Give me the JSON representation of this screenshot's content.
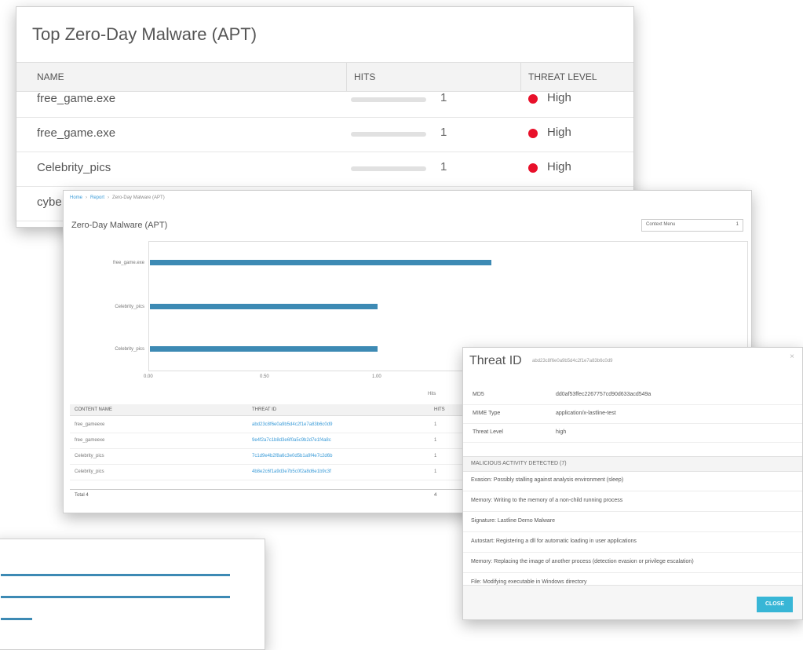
{
  "top_widget": {
    "title": "Top Zero-Day Malware (APT)",
    "columns": [
      "NAME",
      "HITS",
      "THREAT LEVEL"
    ],
    "rows": [
      {
        "name": "free_game.exe",
        "hits": "1",
        "level": "High"
      },
      {
        "name": "free_game.exe",
        "hits": "1",
        "level": "High"
      },
      {
        "name": "Celebrity_pics",
        "hits": "1",
        "level": "High"
      },
      {
        "name": "cybe",
        "hits": "",
        "level": ""
      }
    ],
    "level_color": "#e8102a"
  },
  "detail": {
    "breadcrumb": [
      "Home",
      "Report",
      "Zero-Day Malware (APT)"
    ],
    "title": "Zero-Day Malware (APT)",
    "context_menu": {
      "label": "Context Menu",
      "value": "1"
    },
    "chart_data": {
      "type": "bar",
      "orientation": "horizontal",
      "categories": [
        "free_game.exe",
        "Celebrity_pics",
        "Celebrity_pics"
      ],
      "values": [
        1.5,
        1.0,
        1.0
      ],
      "xticks": [
        "0.00",
        "0.50",
        "1.00"
      ],
      "xlabel": "Hits",
      "xlim": [
        0,
        1.6
      ],
      "bar_color": "#3d8ab4"
    },
    "table": {
      "columns": [
        "CONTENT NAME",
        "THREAT ID",
        "HITS"
      ],
      "rows": [
        {
          "name": "free_gameexe",
          "threat_id": "abd23c8f6e0a9b5d4c2f1e7a83b6c0d9",
          "hits": "1"
        },
        {
          "name": "free_gameexe",
          "threat_id": "9e4f2a7c1b8d3e6f0a5c9b2d7e1f4a8c",
          "hits": "1"
        },
        {
          "name": "Celebrity_pics",
          "threat_id": "7c1d9e4b2f8a6c3e0d5b1a9f4e7c2d6b",
          "hits": "1"
        },
        {
          "name": "Celebrity_pics",
          "threat_id": "4b8e2c6f1a9d3e7b5c0f2a8d6e1b9c3f",
          "hits": "1"
        }
      ],
      "footer": {
        "label": "Total 4",
        "value": "4"
      }
    }
  },
  "modal": {
    "title": "Threat ID",
    "id_value": "abd23c8f6e0a9b5d4c2f1e7a83b6c0d9",
    "close_x": "×",
    "fields": [
      {
        "key": "MD5",
        "value": "dd0af53ffec2267757cd90d633acd549a"
      },
      {
        "key": "MIME Type",
        "value": "application/x-lastline-test"
      },
      {
        "key": "Threat Level",
        "value": "high"
      }
    ],
    "section_title": "MALICIOUS ACTIVITY DETECTED (7)",
    "activities": [
      "Evasion: Possibly stalling against analysis environment (sleep)",
      "Memory: Writing to the memory of a non-child running process",
      "Signature: Lastline Demo Malware",
      "Autostart: Registering a dll for automatic loading in user applications",
      "Memory: Replacing the image of another process (detection evasion or privilege escalation)",
      "File: Modifying executable in Windows directory"
    ],
    "close_label": "CLOSE",
    "accent": "#38b6d6"
  }
}
